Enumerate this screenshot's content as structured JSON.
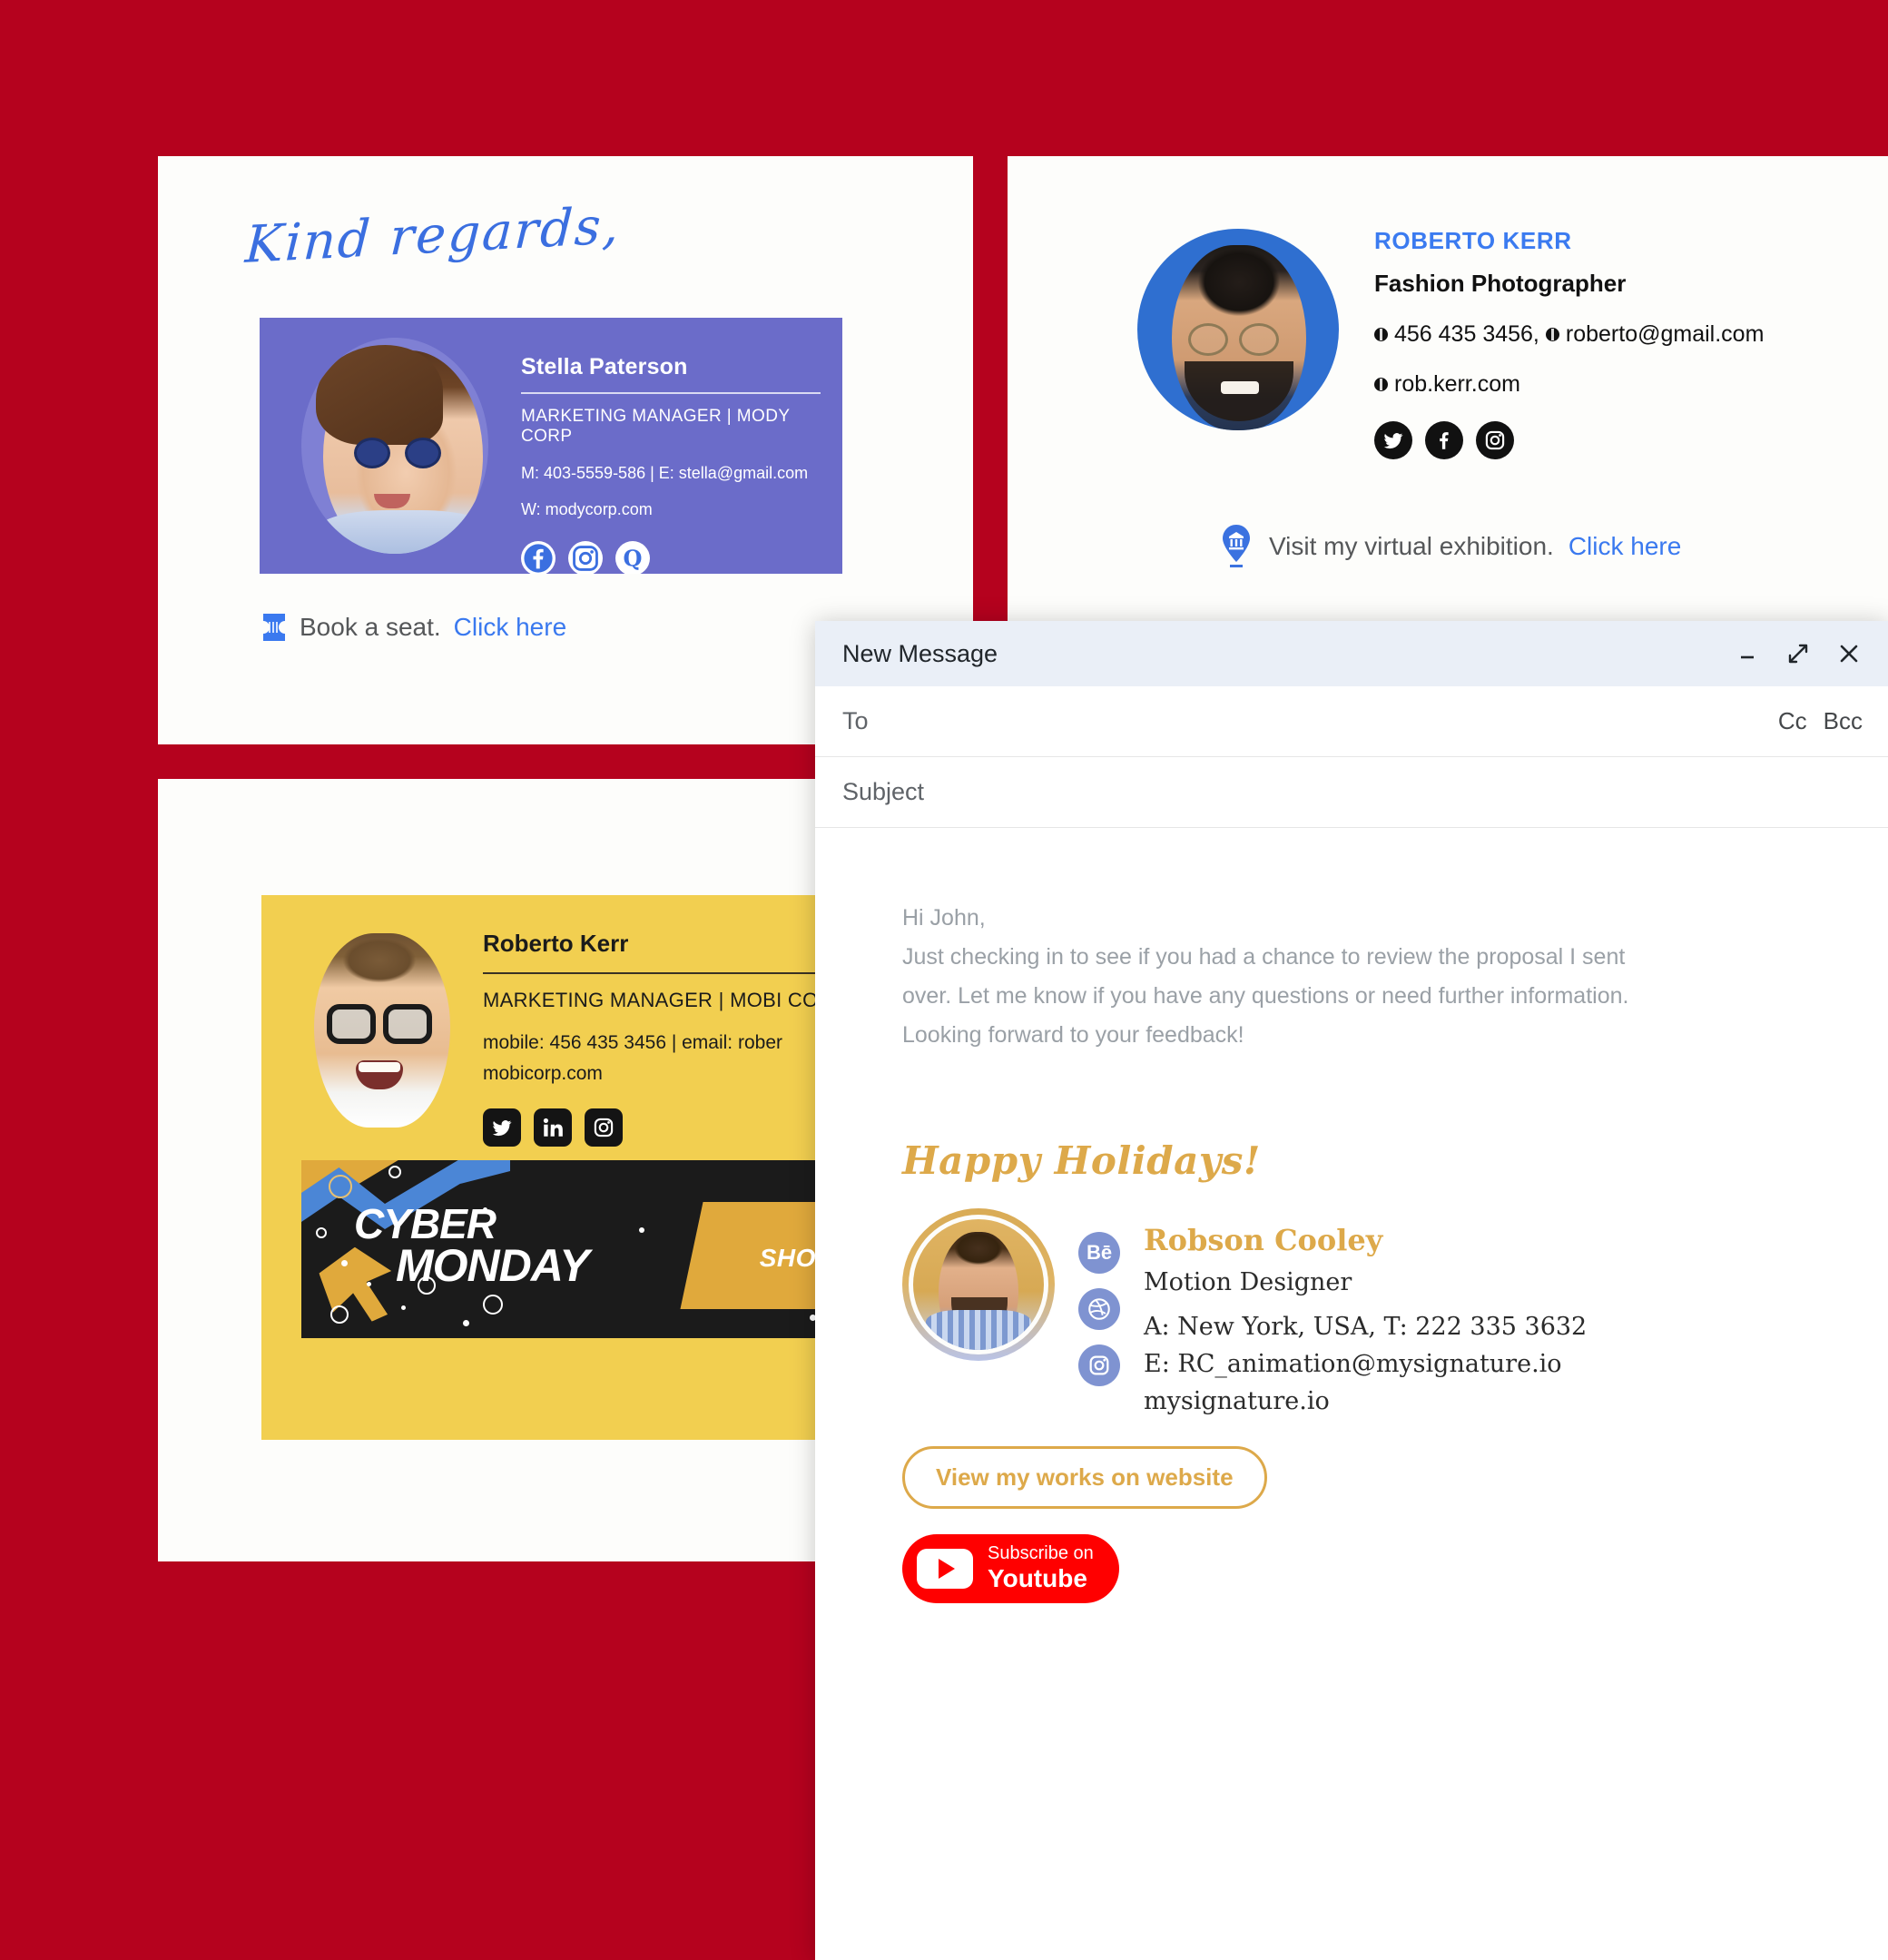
{
  "background_color": "#b5021e",
  "card_stella": {
    "greeting": "Kind regards,",
    "name": "Stella Paterson",
    "role": "MARKETING MANAGER  |  MODY CORP",
    "contact_line1": "M: 403-5559-586  |  E: stella@gmail.com",
    "contact_line2": "W: modycorp.com",
    "socials": [
      "facebook-icon",
      "instagram-icon",
      "quora-icon"
    ],
    "cta_text": "Book a seat.",
    "cta_link": "Click here",
    "cta_icon": "ticket-icon",
    "card_color": "#6b6cc9"
  },
  "card_roberto": {
    "name": "ROBERTO KERR",
    "role": "Fashion Photographer",
    "contact_line1": "456 435 3456,",
    "contact_line2": "roberto@gmail.com",
    "contact_line3": "rob.kerr.com",
    "socials": [
      "twitter-icon",
      "facebook-icon",
      "instagram-icon"
    ],
    "cta_text": "Visit my virtual exhibition.",
    "cta_link": "Click here",
    "cta_icon": "museum-pin-icon",
    "name_color": "#3b7bf0",
    "avatar_bg": "#2f6fd0"
  },
  "card_yellow": {
    "name": "Roberto Kerr",
    "role": "MARKETING MANAGER  |  MOBI CORP",
    "contact_line1": "mobile: 456 435 3456  |  email: rober",
    "contact_line2": "mobicorp.com",
    "socials": [
      "twitter-icon",
      "linkedin-icon",
      "instagram-icon"
    ],
    "card_color": "#f2cf50",
    "banner": {
      "line1": "CYBER",
      "line2": "MONDAY",
      "cta": "SHOP N",
      "bg_color": "#1b1b1b",
      "accent_gold": "#e0a93c",
      "accent_blue": "#4b86d6"
    }
  },
  "compose": {
    "title": "New Message",
    "window_controls": {
      "minimize": "minimize-icon",
      "expand": "expand-icon",
      "close": "close-icon"
    },
    "to_label": "To",
    "to_value": "",
    "cc_label": "Cc",
    "bcc_label": "Bcc",
    "subject_label": "Subject",
    "subject_value": "",
    "body": {
      "line1": "Hi John,",
      "line2": "Just checking in to see if you had a chance to review the proposal I sent",
      "line3": "over. Let me know if you have any questions or need further information.",
      "line4": "Looking forward to your feedback!"
    },
    "signature": {
      "greeting": "Happy Holidays!",
      "name": "Robson Cooley",
      "role": "Motion Designer",
      "address": "A: New York, USA, T: 222 335 3632",
      "email": "E: RC_animation@mysignature.io",
      "website": "mysignature.io",
      "icons": [
        {
          "name": "behance-icon",
          "glyph": "Bē"
        },
        {
          "name": "dribbble-icon",
          "glyph": ""
        },
        {
          "name": "instagram-icon",
          "glyph": ""
        }
      ],
      "button_works": "View my works on website",
      "youtube_small": "Subscribe on",
      "youtube_big": "Youtube",
      "accent_color": "#dda94a",
      "youtube_color": "#ff0000"
    }
  }
}
